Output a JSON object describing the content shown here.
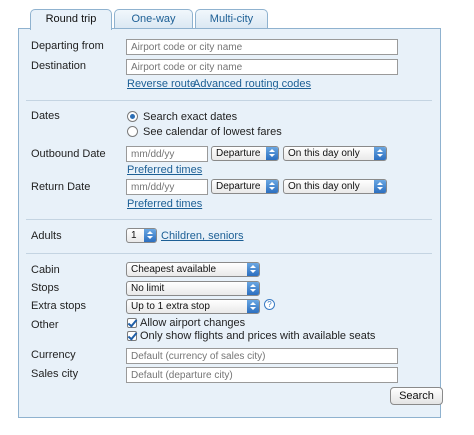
{
  "tabs": [
    {
      "label": "Round trip",
      "active": true
    },
    {
      "label": "One-way",
      "active": false
    },
    {
      "label": "Multi-city",
      "active": false
    }
  ],
  "route": {
    "departing_label": "Departing from",
    "departing_placeholder": "Airport code or city name",
    "destination_label": "Destination",
    "destination_placeholder": "Airport code or city name",
    "reverse_link": "Reverse route",
    "advanced_link": "Advanced routing codes"
  },
  "dates": {
    "label": "Dates",
    "option_exact": "Search exact dates",
    "option_calendar": "See calendar of lowest fares",
    "selected": "exact",
    "outbound_label": "Outbound Date",
    "outbound_placeholder": "mm/dd/yy",
    "outbound_type": "Departure",
    "outbound_range": "On this day only",
    "outbound_preferred": "Preferred times",
    "return_label": "Return Date",
    "return_placeholder": "mm/dd/yy",
    "return_type": "Departure",
    "return_range": "On this day only",
    "return_preferred": "Preferred times"
  },
  "passengers": {
    "adults_label": "Adults",
    "adults_value": "1",
    "children_link": "Children, seniors"
  },
  "options": {
    "cabin_label": "Cabin",
    "cabin_value": "Cheapest available",
    "stops_label": "Stops",
    "stops_value": "No limit",
    "extra_label": "Extra stops",
    "extra_value": "Up to 1 extra stop",
    "help_glyph": "?",
    "other_label": "Other",
    "allow_airport_changes": "Allow airport changes",
    "allow_airport_changes_checked": true,
    "only_available": "Only show flights and prices with available seats",
    "only_available_checked": true,
    "currency_label": "Currency",
    "currency_placeholder": "Default (currency of sales city)",
    "sales_label": "Sales city",
    "sales_placeholder": "Default (departure city)"
  },
  "search_button": "Search",
  "colors": {
    "panel_bg": "#e8f1f9",
    "border": "#8fb2cf",
    "link": "#1c5f95",
    "select_arrow": "#2c6fc0"
  }
}
